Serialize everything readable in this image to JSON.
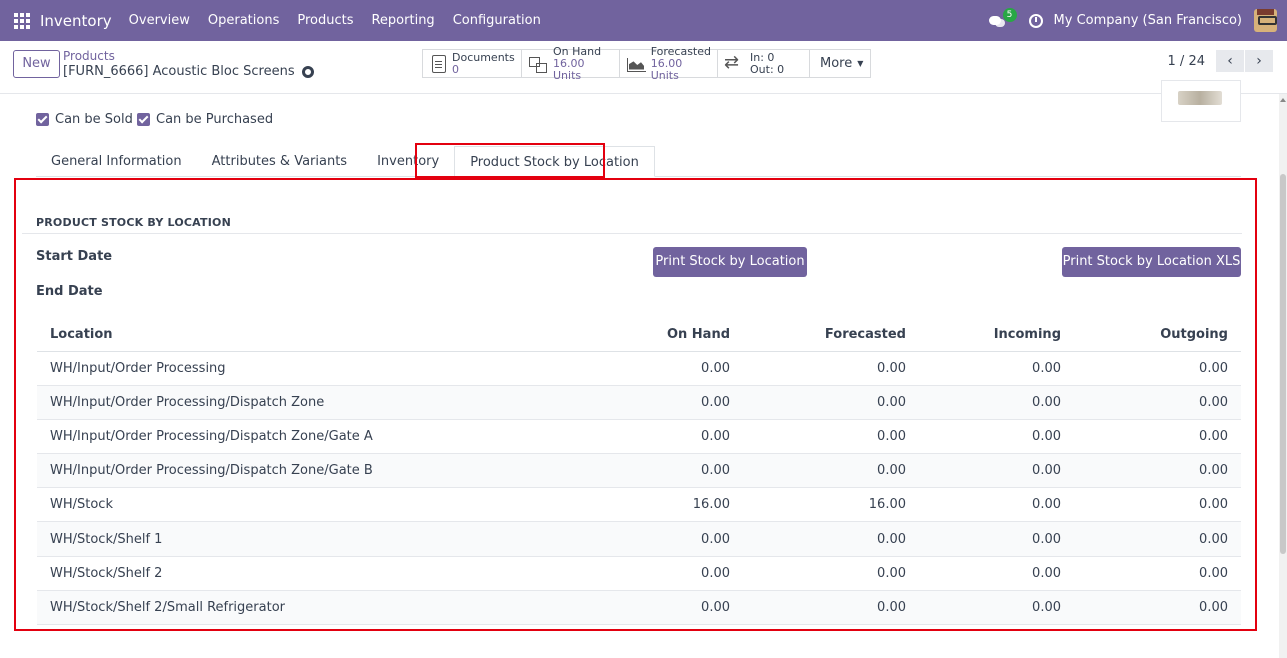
{
  "navbar": {
    "app_name": "Inventory",
    "menu": [
      "Overview",
      "Operations",
      "Products",
      "Reporting",
      "Configuration"
    ],
    "chat_count": "5",
    "company": "My Company (San Francisco)"
  },
  "control": {
    "new_label": "New",
    "breadcrumb_parent": "Products",
    "breadcrumb_current": "[FURN_6666] Acoustic Bloc Screens",
    "smart_buttons": {
      "documents": {
        "label": "Documents",
        "value": "0"
      },
      "on_hand": {
        "label": "On Hand",
        "value": "16.00 Units"
      },
      "forecasted": {
        "label": "Forecasted",
        "value": "16.00 Units"
      },
      "in_out": {
        "in": "In: 0",
        "out": "Out: 0"
      },
      "more": "More"
    },
    "pager": "1 / 24"
  },
  "form": {
    "can_be_sold": "Can be Sold",
    "can_be_purchased": "Can be Purchased",
    "tabs": [
      "General Information",
      "Attributes & Variants",
      "Inventory",
      "Product Stock by Location"
    ],
    "section_title": "PRODUCT STOCK BY LOCATION",
    "start_date_label": "Start Date",
    "end_date_label": "End Date",
    "print_button": "Print Stock by Location",
    "print_xls_button": "Print Stock by Location XLS",
    "table": {
      "headers": [
        "Location",
        "On Hand",
        "Forecasted",
        "Incoming",
        "Outgoing"
      ],
      "rows": [
        [
          "WH/Input/Order Processing",
          "0.00",
          "0.00",
          "0.00",
          "0.00"
        ],
        [
          "WH/Input/Order Processing/Dispatch Zone",
          "0.00",
          "0.00",
          "0.00",
          "0.00"
        ],
        [
          "WH/Input/Order Processing/Dispatch Zone/Gate A",
          "0.00",
          "0.00",
          "0.00",
          "0.00"
        ],
        [
          "WH/Input/Order Processing/Dispatch Zone/Gate B",
          "0.00",
          "0.00",
          "0.00",
          "0.00"
        ],
        [
          "WH/Stock",
          "16.00",
          "16.00",
          "0.00",
          "0.00"
        ],
        [
          "WH/Stock/Shelf 1",
          "0.00",
          "0.00",
          "0.00",
          "0.00"
        ],
        [
          "WH/Stock/Shelf 2",
          "0.00",
          "0.00",
          "0.00",
          "0.00"
        ],
        [
          "WH/Stock/Shelf 2/Small Refrigerator",
          "0.00",
          "0.00",
          "0.00",
          "0.00"
        ]
      ]
    }
  },
  "colors": {
    "brand": "#71639e",
    "highlight": "#e3000f",
    "badge": "#28a745"
  }
}
